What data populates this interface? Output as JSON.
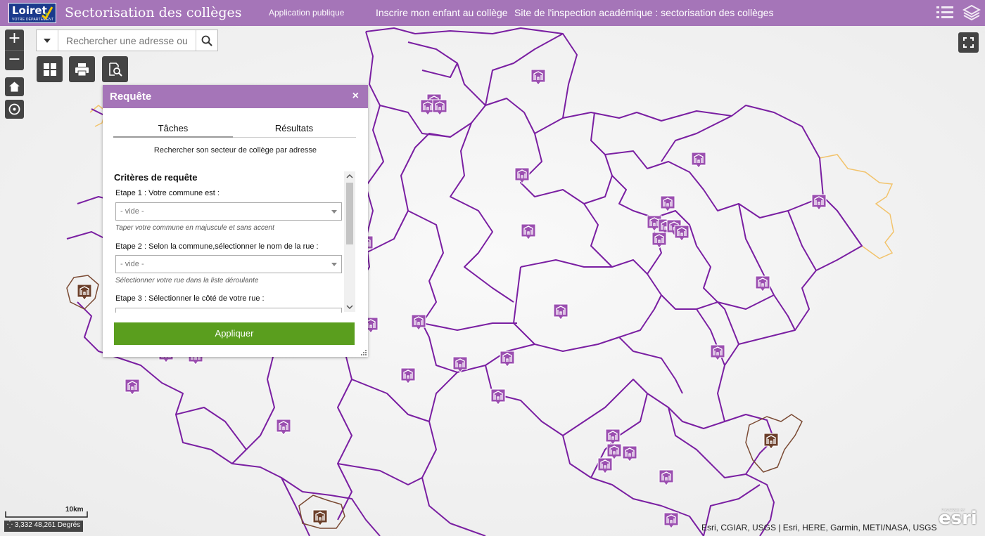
{
  "header": {
    "logo_text": "Loiret",
    "logo_subtext": "VOTRE DÉPARTEMENT",
    "title": "Sectorisation des collèges",
    "links": [
      "Application publique",
      "Inscrire mon enfant au collège",
      "Site de l'inspection académique : sectorisation des collèges"
    ],
    "icons": [
      "menu-list-icon",
      "layers-icon"
    ]
  },
  "search": {
    "placeholder": "Rechercher une adresse ou"
  },
  "controls": {
    "zoom_in": "+",
    "zoom_out": "−",
    "icons": [
      "home-icon",
      "locate-icon",
      "basemap-gallery-icon",
      "print-icon",
      "query-icon",
      "fullscreen-icon"
    ]
  },
  "panel": {
    "title": "Requête",
    "close": "×",
    "tabs": [
      "Tâches",
      "Résultats"
    ],
    "description": "Rechercher son secteur de collège par adresse",
    "criteria_title": "Critères de requête",
    "step1_label": "Etape 1 : Votre commune est :",
    "step1_value": "- vide -",
    "step1_hint": "Taper votre commune en majuscule et sans accent",
    "step2_label": "Etape 2 : Selon la commune,sélectionner le nom de la rue :",
    "step2_value": "- vide -",
    "step2_hint": "Sélectionner votre rue dans la liste déroulante",
    "step3_label": "Etape 3 : Sélectionner le côté de votre rue :",
    "apply": "Appliquer"
  },
  "map": {
    "scale_label": "10km",
    "coordinates": "3,332 48,261 Degrés",
    "attribution": "Esri, CGIAR, USGS | Esri, HERE, Garmin, METI/NASA, USGS",
    "esri_logo": "esri",
    "esri_powered": "POWERED BY",
    "colors": {
      "header": "#a575b8",
      "boundary": "#7a1fa2",
      "marker": "#9b4fb0",
      "marker_alt": "#6b3f2a",
      "neighbor_boundary": "#f2c36b",
      "apply": "#5a9e1e"
    }
  }
}
